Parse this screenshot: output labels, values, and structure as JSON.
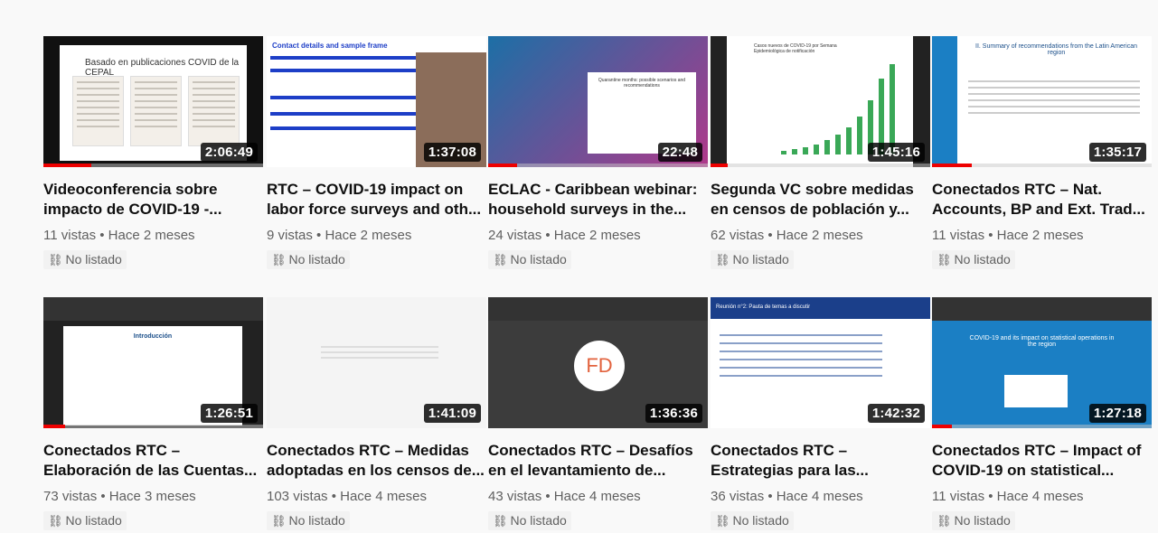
{
  "videos": [
    {
      "title": "Videoconferencia sobre impacto de COVID-19 -...",
      "meta": "11 vistas • Hace 2 meses",
      "badge": "No listado",
      "duration": "2:06:49",
      "progress": 0.22,
      "thumb_text": "Basado en publicaciones COVID de la CEPAL"
    },
    {
      "title": "RTC – COVID-19 impact on labor force surveys and oth...",
      "meta": "9 vistas • Hace 2 meses",
      "badge": "No listado",
      "duration": "1:37:08",
      "progress": 0.0,
      "thumb_text": "Contact details and sample frame"
    },
    {
      "title": "ECLAC - Caribbean webinar: household surveys in the...",
      "meta": "24 vistas • Hace 2 meses",
      "badge": "No listado",
      "duration": "22:48",
      "progress": 0.13,
      "thumb_text": "Quarantine months: possible scenarios and recommendations"
    },
    {
      "title": "Segunda VC sobre medidas en censos de población y...",
      "meta": "62 vistas • Hace 2 meses",
      "badge": "No listado",
      "duration": "1:45:16",
      "progress": 0.08,
      "thumb_text": "Casos nuevos de COVID-19 por Semana Epidemiológica de notificación"
    },
    {
      "title": "Conectados RTC – Nat. Accounts, BP and Ext. Trad...",
      "meta": "11 vistas • Hace 2 meses",
      "badge": "No listado",
      "duration": "1:35:17",
      "progress": 0.18,
      "thumb_text": "II. Summary of recommendations from the Latin American region"
    },
    {
      "title": "Conectados RTC – Elaboración de las Cuentas...",
      "meta": "73 vistas • Hace 3 meses",
      "badge": "No listado",
      "duration": "1:26:51",
      "progress": 0.1,
      "thumb_text": "Introducción"
    },
    {
      "title": "Conectados RTC – Medidas adoptadas en los censos de...",
      "meta": "103 vistas • Hace 4 meses",
      "badge": "No listado",
      "duration": "1:41:09",
      "progress": 0.0,
      "thumb_text": ""
    },
    {
      "title": "Conectados RTC – Desafíos en el levantamiento de...",
      "meta": "43 vistas • Hace 4 meses",
      "badge": "No listado",
      "duration": "1:36:36",
      "progress": 0.0,
      "thumb_text": "FD"
    },
    {
      "title": "Conectados RTC – Estrategias para las...",
      "meta": "36 vistas • Hace 4 meses",
      "badge": "No listado",
      "duration": "1:42:32",
      "progress": 0.0,
      "thumb_text": "Reunión n°2: Pauta de temas a discutir"
    },
    {
      "title": "Conectados RTC – Impact of COVID-19 on statistical...",
      "meta": "11 vistas • Hace 4 meses",
      "badge": "No listado",
      "duration": "1:27:18",
      "progress": 0.09,
      "thumb_text": "COVID-19 and its impact on statistical operations in the region"
    }
  ],
  "colors": {
    "progress": "#e00000",
    "meta": "#606060"
  },
  "icons": {
    "badge": "link-icon"
  }
}
